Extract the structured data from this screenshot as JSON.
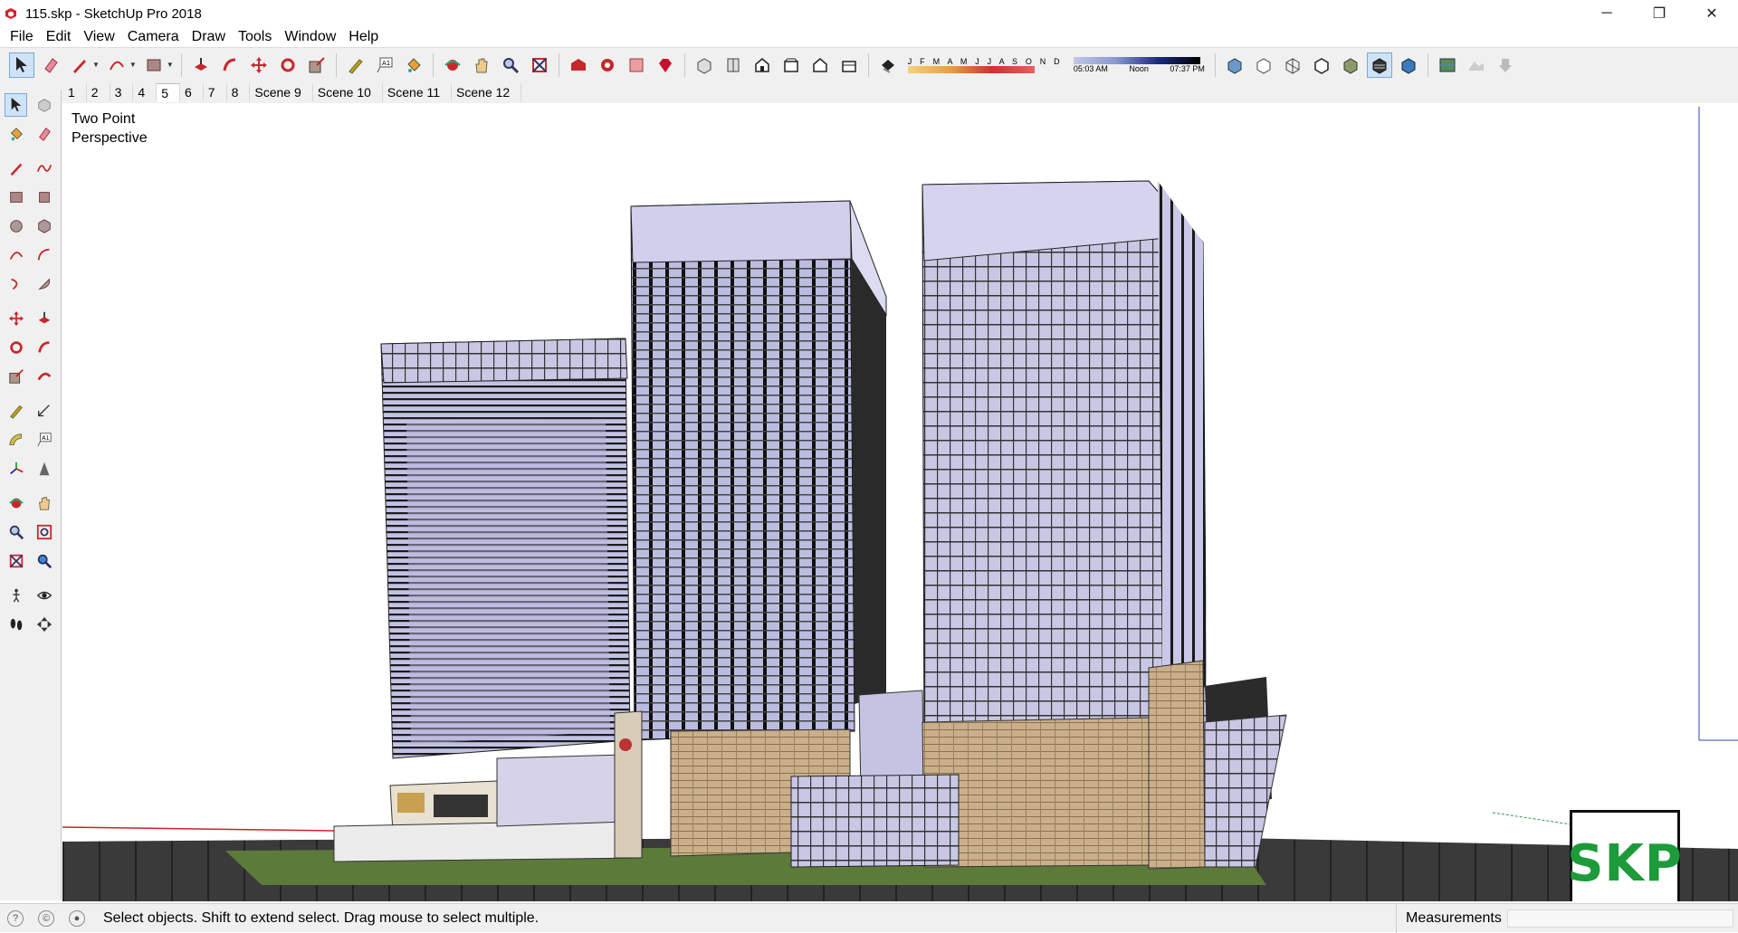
{
  "window": {
    "title": "115.skp - SketchUp Pro 2018",
    "minimize": "─",
    "restore": "❐",
    "close": "✕"
  },
  "menu": [
    "File",
    "Edit",
    "View",
    "Camera",
    "Draw",
    "Tools",
    "Window",
    "Help"
  ],
  "toolbar": {
    "months": "J F M A M J J A S O N D",
    "times": [
      "05:03 AM",
      "Noon",
      "07:37 PM"
    ]
  },
  "scenes": {
    "tabs": [
      "1",
      "2",
      "3",
      "4",
      "5",
      "6",
      "7",
      "8",
      "Scene 9",
      "Scene 10",
      "Scene 11",
      "Scene 12"
    ],
    "active_index": 4
  },
  "viewport": {
    "camera_line1": "Two Point",
    "camera_line2": "Perspective",
    "logo_text": "SKP"
  },
  "status": {
    "hint": "Select objects. Shift to extend select. Drag mouse to select multiple.",
    "measurements_label": "Measurements",
    "measurements_value": ""
  },
  "colors": {
    "accent_logo": "#1d9b3a",
    "ground": "#3a3a3a",
    "grass": "#5c7a3a",
    "glass": "#c9c8e6",
    "stone": "#c9b08a"
  }
}
